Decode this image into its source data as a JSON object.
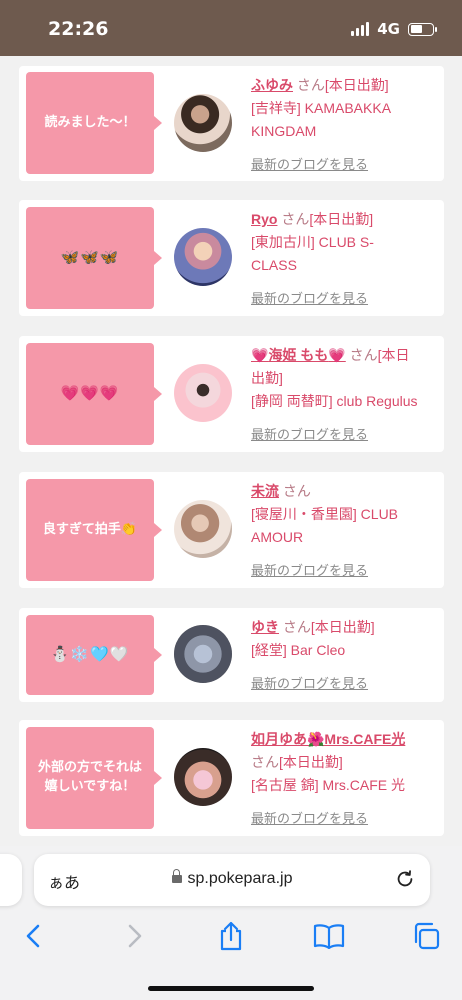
{
  "status_bar": {
    "time": "22:26",
    "network": "4G",
    "battery_level": 0.55
  },
  "posts": [
    {
      "comment": "読みました〜！",
      "name": "ふゆみ",
      "honorific": "さん",
      "status": "[本日出勤]",
      "line2": "[吉祥寺] KAMABAKKA",
      "line3": "KINGDAM",
      "blog_link": "最新のブログを見る"
    },
    {
      "comment": "🦋🦋🦋",
      "name": "Ryo",
      "honorific": "さん",
      "status": "[本日出勤]",
      "line2": "[東加古川] CLUB S-",
      "line3": "CLASS",
      "blog_link": "最新のブログを見る"
    },
    {
      "comment": "💗💗💗",
      "name_prefix": "💗",
      "name": "海姫 もも",
      "name_suffix": "💗",
      "honorific": "さん",
      "status_a": "[本日",
      "status_b": "出勤]",
      "line3": "[静岡 両替町] club Regulus",
      "blog_link": "最新のブログを見る"
    },
    {
      "comment": "良すぎて拍手👏",
      "name": "未流",
      "honorific": "さん",
      "line2": "[寝屋川・香里園] CLUB",
      "line3": "AMOUR",
      "blog_link": "最新のブログを見る"
    },
    {
      "comment": "⛄❄️🩵🤍",
      "name": "ゆき",
      "honorific": "さん",
      "status": "[本日出勤]",
      "line2": "[経堂] Bar Cleo",
      "blog_link": "最新のブログを見る"
    },
    {
      "comment_line1": "外部の方でそれは",
      "comment_line2": "嬉しいですね！",
      "name": "如月ゆあ🌺Mrs.CAFE光",
      "honorific": "さん",
      "status": "[本日出勤]",
      "line3": "[名古屋 錦] Mrs.CAFE 光",
      "blog_link": "最新のブログを見る"
    }
  ],
  "browser": {
    "aa_label": "ぁあ",
    "url": "sp.pokepara.jp",
    "toolbar": [
      "back-icon",
      "forward-icon",
      "share-icon",
      "bookmarks-icon",
      "tabs-icon"
    ]
  },
  "colors": {
    "accent_pink": "#f598a9",
    "link_pink": "#d94a6a",
    "status_bar": "#6e5a4e"
  }
}
